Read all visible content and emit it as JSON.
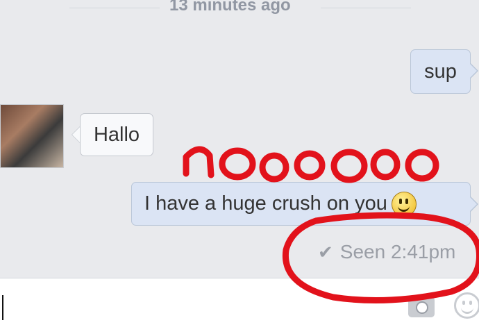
{
  "header": {
    "timestamp": "13 minutes ago"
  },
  "messages": [
    {
      "direction": "sent",
      "text": "sup"
    },
    {
      "direction": "received",
      "text": "Hallo",
      "avatar_icon": "user-photo"
    },
    {
      "direction": "sent",
      "text": "I have a huge crush on you",
      "emoji": "smiley-emoji"
    }
  ],
  "status": {
    "seen_label": "Seen 2:41pm",
    "check_icon": "check-icon"
  },
  "annotation": {
    "text": "noooooo",
    "color": "#e2121b"
  },
  "composer": {
    "placeholder": "",
    "icons": [
      "camera-icon",
      "emoji-icon"
    ]
  },
  "colors": {
    "background": "#e9eaed",
    "sent_bubble": "#dbe4f4",
    "received_bubble": "#f8f9fb"
  }
}
